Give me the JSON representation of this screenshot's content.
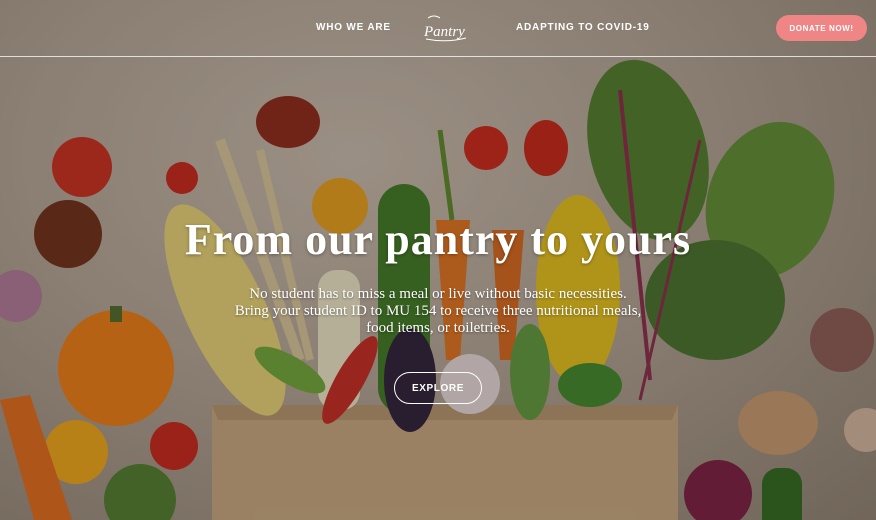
{
  "nav": {
    "who_we_are": "WHO WE ARE",
    "adapting": "ADAPTING TO COVID-19",
    "logo_text": "Pantry",
    "donate": "DONATE NOW!"
  },
  "hero": {
    "title": "From our pantry to yours",
    "lines": [
      "No student has to miss a meal or live without basic necessities.",
      "Bring your student ID to MU 154 to receive three nutritional meals,",
      "food items, or toiletries."
    ],
    "explore": "EXPLORE"
  },
  "colors": {
    "donate_bg": "#ef8585",
    "text": "#ffffff"
  }
}
